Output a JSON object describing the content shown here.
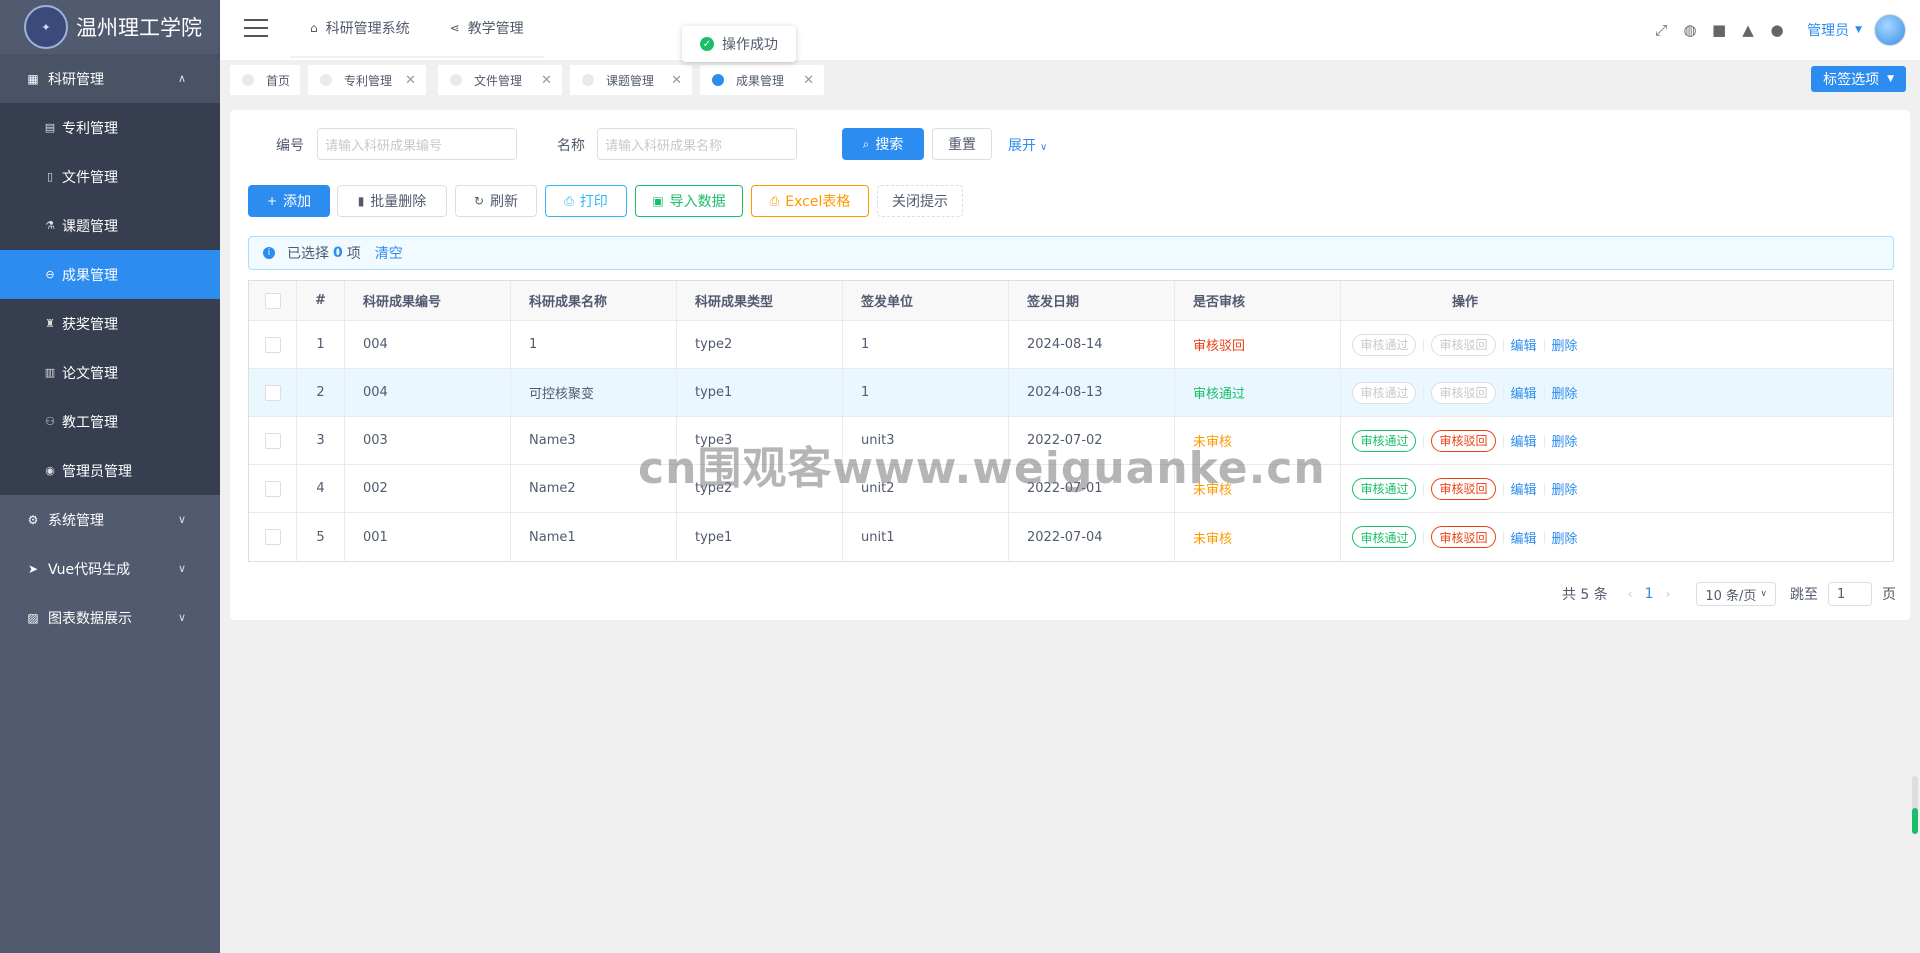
{
  "sidebar": {
    "school_name": "温州理工学院",
    "groups": [
      {
        "label": "科研管理",
        "icon": "grid-icon",
        "open": true,
        "items": [
          {
            "label": "专利管理",
            "icon": "book-icon"
          },
          {
            "label": "文件管理",
            "icon": "file-icon"
          },
          {
            "label": "课题管理",
            "icon": "flask-icon"
          },
          {
            "label": "成果管理",
            "icon": "minus-circle-icon",
            "active": true
          },
          {
            "label": "获奖管理",
            "icon": "trophy-icon"
          },
          {
            "label": "论文管理",
            "icon": "book-open-icon"
          },
          {
            "label": "教工管理",
            "icon": "people-icon"
          },
          {
            "label": "管理员管理",
            "icon": "user-circle-icon"
          }
        ]
      },
      {
        "label": "系统管理",
        "icon": "gear-icon"
      },
      {
        "label": "Vue代码生成",
        "icon": "send-icon"
      },
      {
        "label": "图表数据展示",
        "icon": "chart-icon"
      }
    ]
  },
  "header": {
    "nav": [
      {
        "label": "科研管理系统",
        "icon": "home-icon"
      },
      {
        "label": "教学管理",
        "icon": "share-icon"
      }
    ],
    "toast": "操作成功",
    "user": "管理员",
    "icons": [
      "fullscreen-icon",
      "globe-icon",
      "lock-icon",
      "bell-icon",
      "github-icon"
    ]
  },
  "tags": {
    "items": [
      {
        "label": "首页",
        "closable": false
      },
      {
        "label": "专利管理",
        "closable": true
      },
      {
        "label": "文件管理",
        "closable": true
      },
      {
        "label": "课题管理",
        "closable": true
      },
      {
        "label": "成果管理",
        "closable": true,
        "active": true
      }
    ],
    "options_label": "标签选项"
  },
  "search": {
    "id_label": "编号",
    "id_placeholder": "请输入科研成果编号",
    "name_label": "名称",
    "name_placeholder": "请输入科研成果名称",
    "search_btn": "搜索",
    "reset_btn": "重置",
    "expand": "展开"
  },
  "toolbar": {
    "add": "添加",
    "batch_delete": "批量删除",
    "refresh": "刷新",
    "print": "打印",
    "import": "导入数据",
    "excel": "Excel表格",
    "close_tip": "关闭提示"
  },
  "alert": {
    "prefix": "已选择",
    "count": "0",
    "suffix": "项",
    "clear": "清空"
  },
  "table": {
    "columns": [
      "#",
      "科研成果编号",
      "科研成果名称",
      "科研成果类型",
      "签发单位",
      "签发日期",
      "是否审核",
      "操作"
    ],
    "rows": [
      {
        "idx": "1",
        "code": "004",
        "name": "1",
        "type": "type2",
        "unit": "1",
        "date": "2024-08-14",
        "status": "审核驳回",
        "status_color": "red",
        "enabled": false
      },
      {
        "idx": "2",
        "code": "004",
        "name": "可控核聚变",
        "type": "type1",
        "unit": "1",
        "date": "2024-08-13",
        "status": "审核通过",
        "status_color": "green",
        "enabled": false
      },
      {
        "idx": "3",
        "code": "003",
        "name": "Name3",
        "type": "type3",
        "unit": "unit3",
        "date": "2022-07-02",
        "status": "未审核",
        "status_color": "orange",
        "enabled": true
      },
      {
        "idx": "4",
        "code": "002",
        "name": "Name2",
        "type": "type2",
        "unit": "unit2",
        "date": "2022-07-01",
        "status": "未审核",
        "status_color": "orange",
        "enabled": true
      },
      {
        "idx": "5",
        "code": "001",
        "name": "Name1",
        "type": "type1",
        "unit": "unit1",
        "date": "2022-07-04",
        "status": "未审核",
        "status_color": "orange",
        "enabled": true
      }
    ],
    "op_approve": "审核通过",
    "op_reject": "审核驳回",
    "op_edit": "编辑",
    "op_delete": "删除"
  },
  "pager": {
    "total": "共 5 条",
    "current": "1",
    "page_size": "10 条/页",
    "jump_label": "跳至",
    "jump_value": "1",
    "page_suffix": "页"
  },
  "watermark": "cn围观客www.weiguanke.cn"
}
